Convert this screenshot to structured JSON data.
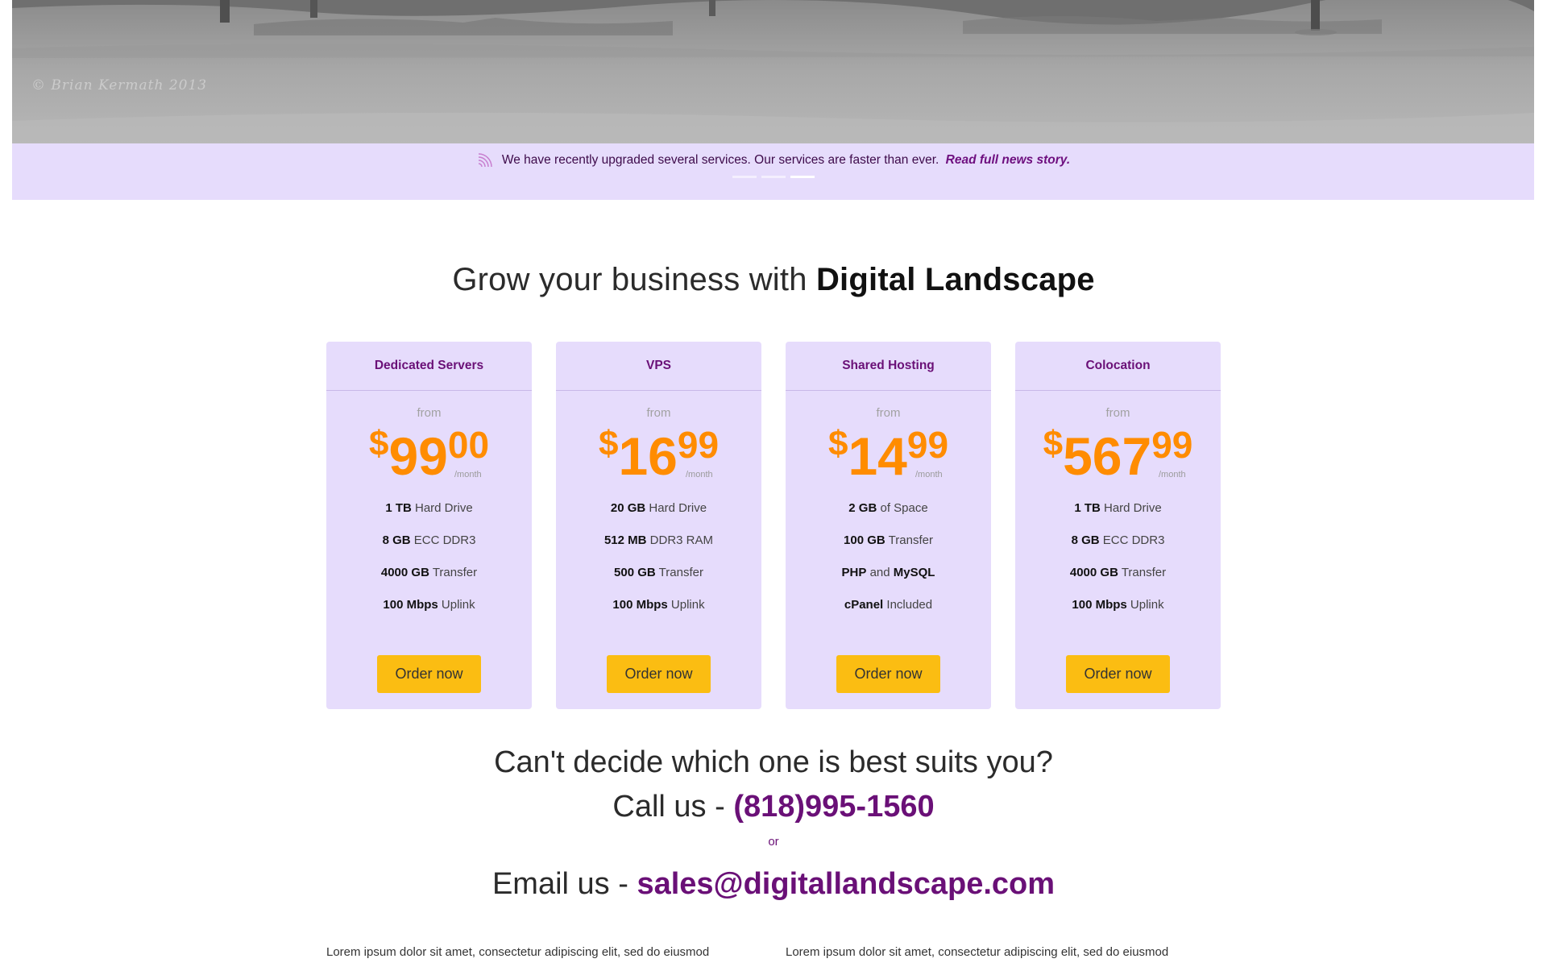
{
  "hero": {
    "credit": "© Brian Kermath 2013"
  },
  "news": {
    "icon": "rss-icon",
    "text": "We have recently upgraded several services. Our services are faster than ever.",
    "link": "Read full news story.",
    "slides_total": 3,
    "slide_active": 3
  },
  "headline": {
    "prefix": "Grow your business with",
    "brand": "Digital Landscape"
  },
  "plans": [
    {
      "title": "Dedicated Servers",
      "from": "from",
      "currency": "$",
      "price_int": "99",
      "price_dec": "00",
      "period": "/month",
      "features": [
        {
          "value": "1 TB",
          "label": "Hard Drive"
        },
        {
          "value": "8 GB",
          "label": "ECC DDR3"
        },
        {
          "value": "4000 GB",
          "label": "Transfer"
        },
        {
          "value": "100 Mbps",
          "label": "Uplink"
        }
      ],
      "button": "Order now"
    },
    {
      "title": "VPS",
      "from": "from",
      "currency": "$",
      "price_int": "16",
      "price_dec": "99",
      "period": "/month",
      "features": [
        {
          "value": "20 GB",
          "label": "Hard Drive"
        },
        {
          "value": "512 MB",
          "label": "DDR3 RAM"
        },
        {
          "value": "500 GB",
          "label": "Transfer"
        },
        {
          "value": "100 Mbps",
          "label": "Uplink"
        }
      ],
      "button": "Order now"
    },
    {
      "title": "Shared Hosting",
      "from": "from",
      "currency": "$",
      "price_int": "14",
      "price_dec": "99",
      "period": "/month",
      "features": [
        {
          "value": "2 GB",
          "label": "of Space"
        },
        {
          "value": "100 GB",
          "label": "Transfer"
        },
        {
          "value": "PHP",
          "label": "and",
          "value2": "MySQL"
        },
        {
          "value": "cPanel",
          "label": "Included"
        }
      ],
      "button": "Order now"
    },
    {
      "title": "Colocation",
      "from": "from",
      "currency": "$",
      "price_int": "567",
      "price_dec": "99",
      "period": "/month",
      "features": [
        {
          "value": "1 TB",
          "label": "Hard Drive"
        },
        {
          "value": "8 GB",
          "label": "ECC DDR3"
        },
        {
          "value": "4000 GB",
          "label": "Transfer"
        },
        {
          "value": "100 Mbps",
          "label": "Uplink"
        }
      ],
      "button": "Order now"
    }
  ],
  "contact": {
    "question": "Can't decide which one is best suits you?",
    "call_prefix": "Call us -",
    "phone": "(818)995-1560",
    "or": "or",
    "email_prefix": "Email us -",
    "email": "sales@digitallandscape.com"
  },
  "footer_text": [
    "Lorem ipsum dolor sit amet, consectetur adipiscing elit, sed do eiusmod",
    "Lorem ipsum dolor sit amet, consectetur adipiscing elit, sed do eiusmod"
  ],
  "colors": {
    "accent_purple": "#6a1077",
    "panel_lavender": "#e6dcfc",
    "price_orange": "#ff8c00",
    "button_yellow": "#fbbd12"
  }
}
